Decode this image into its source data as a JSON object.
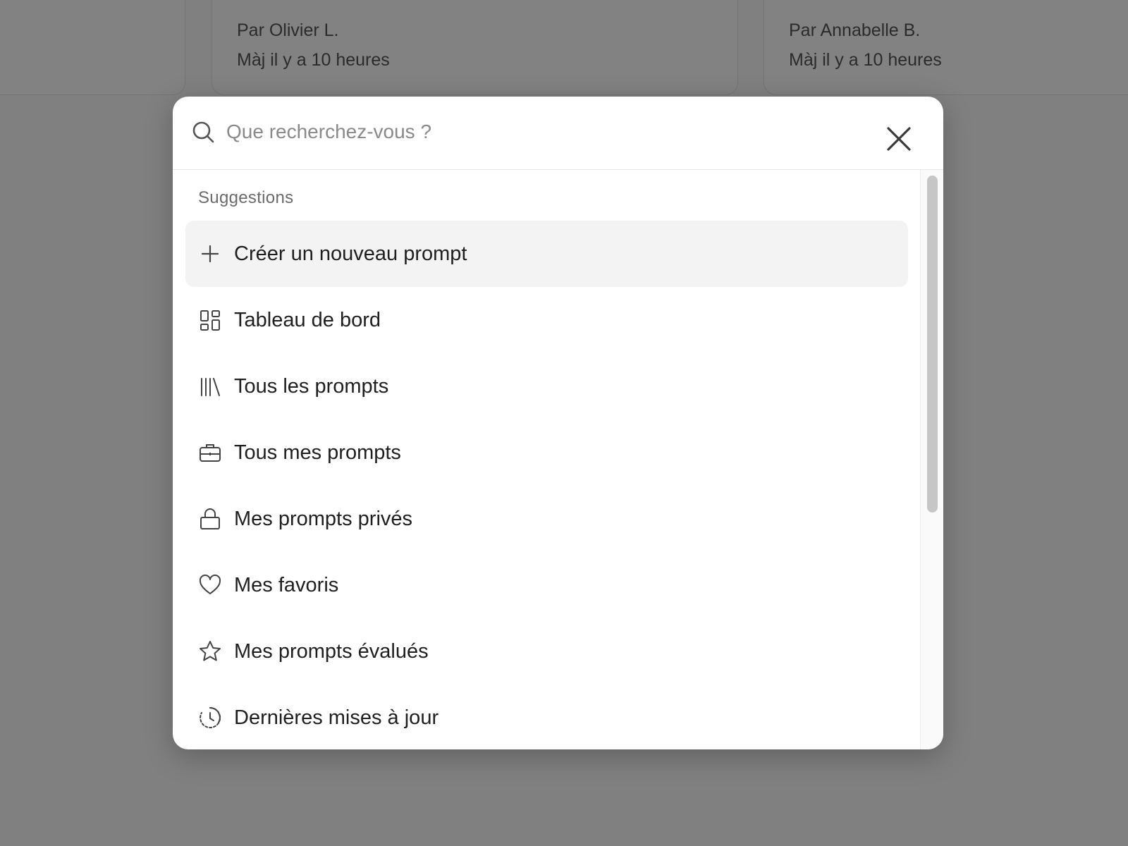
{
  "background": {
    "cards": [
      {
        "author": "",
        "updated": ""
      },
      {
        "author": "Par Olivier L.",
        "updated": "Màj il y a 10 heures"
      },
      {
        "author": "Par Annabelle B.",
        "updated": "Màj il y a 10 heures"
      }
    ]
  },
  "search": {
    "placeholder": "Que recherchez-vous ?",
    "value": ""
  },
  "suggestions": {
    "heading": "Suggestions",
    "items": [
      {
        "label": "Créer un nouveau prompt",
        "icon": "plus-icon",
        "highlighted": true
      },
      {
        "label": "Tableau de bord",
        "icon": "dashboard-icon"
      },
      {
        "label": "Tous les prompts",
        "icon": "library-icon"
      },
      {
        "label": "Tous mes prompts",
        "icon": "briefcase-icon"
      },
      {
        "label": "Mes prompts privés",
        "icon": "lock-icon"
      },
      {
        "label": "Mes favoris",
        "icon": "heart-icon"
      },
      {
        "label": "Mes prompts évalués",
        "icon": "star-icon"
      },
      {
        "label": "Dernières mises à jour",
        "icon": "history-icon"
      }
    ]
  },
  "colors": {
    "overlay": "#000000",
    "highlight_row": "#f3f3f3",
    "text": "#1f1f1f",
    "muted": "#6b6b6b"
  }
}
